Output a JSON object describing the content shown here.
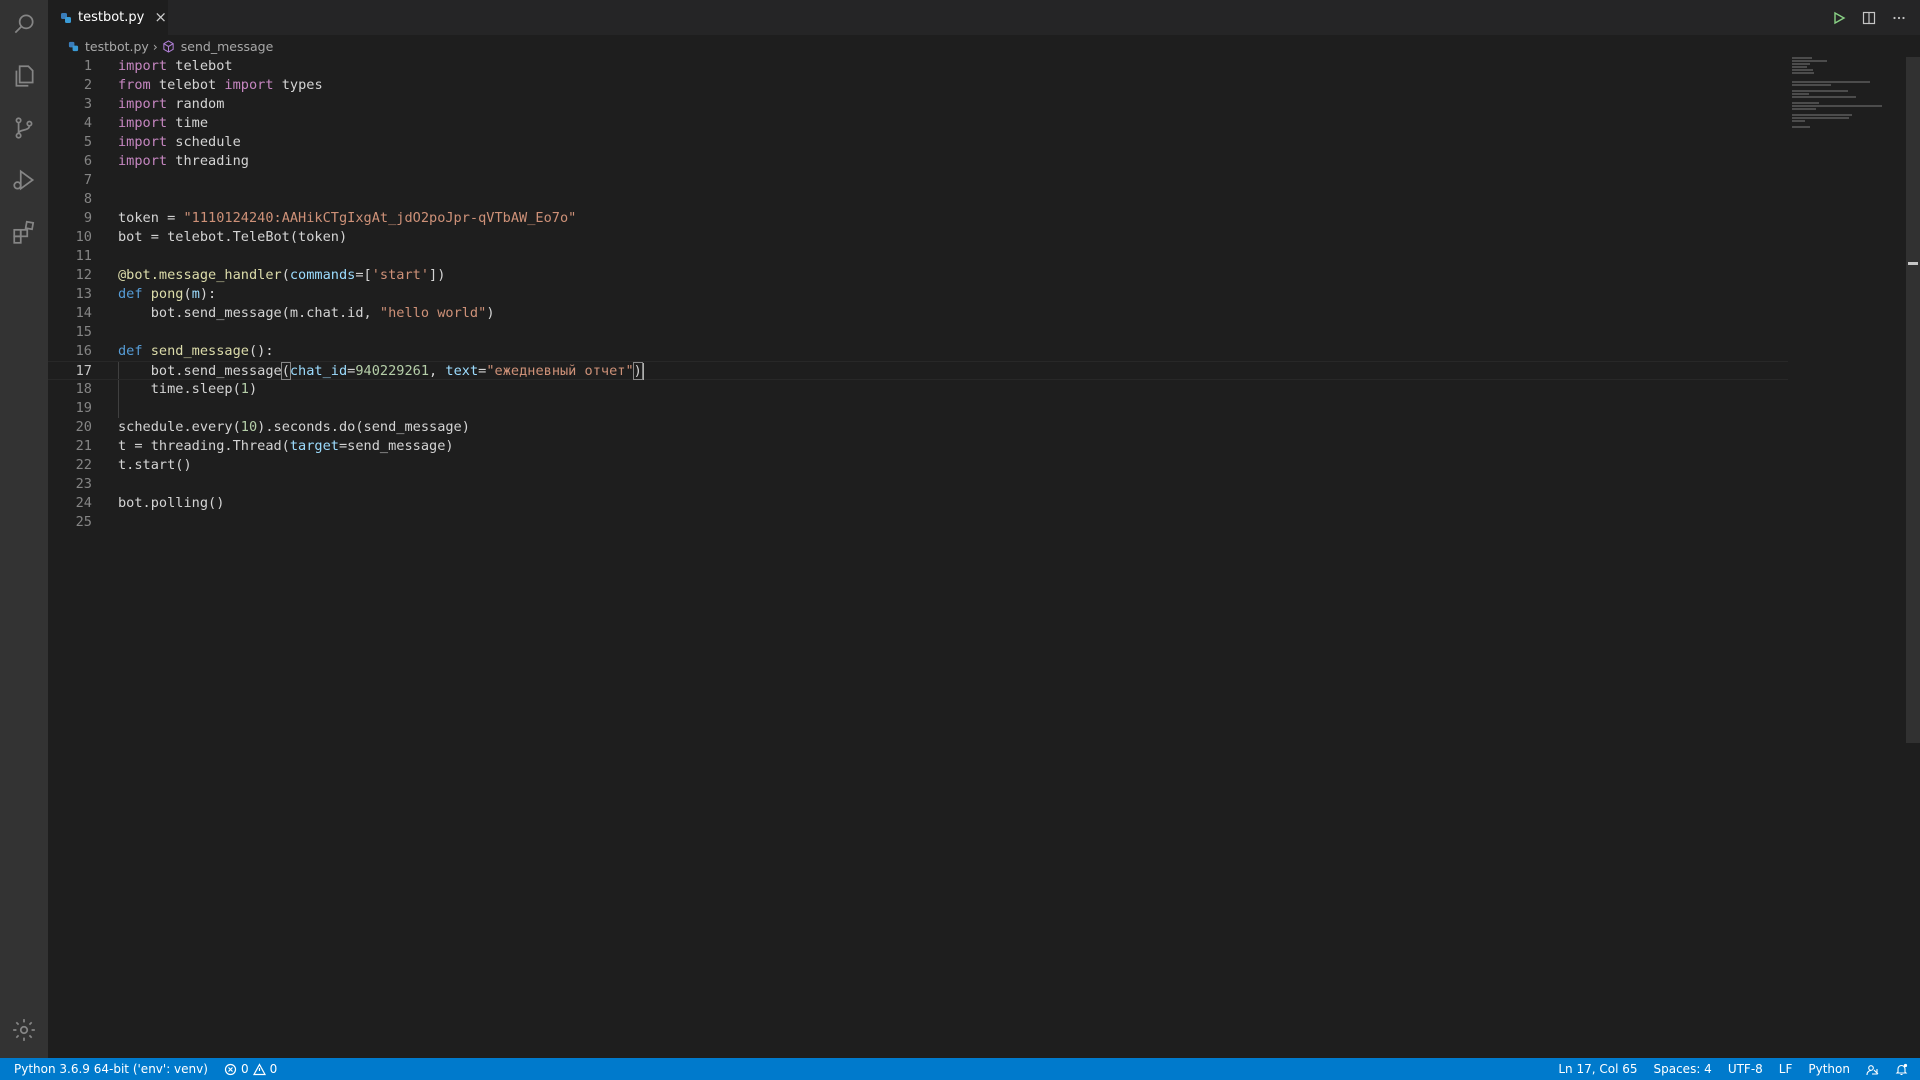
{
  "tab": {
    "filename": "testbot.py",
    "close_glyph": "×"
  },
  "breadcrumb": {
    "file": "testbot.py",
    "symbol": "send_message",
    "separator": "›"
  },
  "activity_bar": [
    "search-icon",
    "explorer-icon",
    "source-control-icon",
    "run-debug-icon",
    "extensions-icon",
    "settings-gear-icon"
  ],
  "editor_actions": [
    "run-icon",
    "split-editor-icon",
    "more-actions-icon"
  ],
  "editor": {
    "current_line": 17,
    "lines": [
      {
        "n": "1",
        "tokens": [
          {
            "t": "import",
            "c": "kw"
          },
          {
            "t": " telebot",
            "c": "plain"
          }
        ]
      },
      {
        "n": "2",
        "tokens": [
          {
            "t": "from",
            "c": "kw"
          },
          {
            "t": " telebot ",
            "c": "plain"
          },
          {
            "t": "import",
            "c": "kw"
          },
          {
            "t": " types",
            "c": "plain"
          }
        ]
      },
      {
        "n": "3",
        "tokens": [
          {
            "t": "import",
            "c": "kw"
          },
          {
            "t": " random",
            "c": "plain"
          }
        ]
      },
      {
        "n": "4",
        "tokens": [
          {
            "t": "import",
            "c": "kw"
          },
          {
            "t": " time",
            "c": "plain"
          }
        ]
      },
      {
        "n": "5",
        "tokens": [
          {
            "t": "import",
            "c": "kw"
          },
          {
            "t": " schedule",
            "c": "plain"
          }
        ]
      },
      {
        "n": "6",
        "tokens": [
          {
            "t": "import",
            "c": "kw"
          },
          {
            "t": " threading",
            "c": "plain"
          }
        ]
      },
      {
        "n": "7",
        "tokens": []
      },
      {
        "n": "8",
        "tokens": []
      },
      {
        "n": "9",
        "tokens": [
          {
            "t": "token = ",
            "c": "plain"
          },
          {
            "t": "\"1110124240:AAHikCTgIxgAt_jdO2poJpr-qVTbAW_Eo7o\"",
            "c": "str"
          }
        ]
      },
      {
        "n": "10",
        "tokens": [
          {
            "t": "bot = telebot.TeleBot(token)",
            "c": "plain"
          }
        ]
      },
      {
        "n": "11",
        "tokens": []
      },
      {
        "n": "12",
        "tokens": [
          {
            "t": "@bot.message_handler",
            "c": "fn"
          },
          {
            "t": "(",
            "c": "plain"
          },
          {
            "t": "commands",
            "c": "param"
          },
          {
            "t": "=[",
            "c": "plain"
          },
          {
            "t": "'start'",
            "c": "str"
          },
          {
            "t": "])",
            "c": "plain"
          }
        ]
      },
      {
        "n": "13",
        "tokens": [
          {
            "t": "def",
            "c": "def"
          },
          {
            "t": " ",
            "c": "plain"
          },
          {
            "t": "pong",
            "c": "fn"
          },
          {
            "t": "(",
            "c": "plain"
          },
          {
            "t": "m",
            "c": "param"
          },
          {
            "t": "):",
            "c": "plain"
          }
        ]
      },
      {
        "n": "14",
        "tokens": [
          {
            "t": "    bot.send_message(m.chat.id, ",
            "c": "plain"
          },
          {
            "t": "\"hello world\"",
            "c": "str"
          },
          {
            "t": ")",
            "c": "plain"
          }
        ]
      },
      {
        "n": "15",
        "tokens": []
      },
      {
        "n": "16",
        "tokens": [
          {
            "t": "def",
            "c": "def"
          },
          {
            "t": " ",
            "c": "plain"
          },
          {
            "t": "send_message",
            "c": "fn"
          },
          {
            "t": "():",
            "c": "plain"
          }
        ]
      },
      {
        "n": "17",
        "tokens": [
          {
            "t": "    bot.send_message",
            "c": "plain"
          },
          {
            "t": "(",
            "c": "plain",
            "hl": true
          },
          {
            "t": "chat_id",
            "c": "param"
          },
          {
            "t": "=",
            "c": "plain"
          },
          {
            "t": "940229261",
            "c": "num"
          },
          {
            "t": ", ",
            "c": "plain"
          },
          {
            "t": "text",
            "c": "param"
          },
          {
            "t": "=",
            "c": "plain"
          },
          {
            "t": "\"ежедневный отчет\"",
            "c": "str"
          },
          {
            "t": ")",
            "c": "plain",
            "hl": true
          },
          {
            "t": "",
            "c": "cursor"
          }
        ]
      },
      {
        "n": "18",
        "tokens": [
          {
            "t": "    time.sleep(",
            "c": "plain"
          },
          {
            "t": "1",
            "c": "num"
          },
          {
            "t": ")",
            "c": "plain"
          }
        ]
      },
      {
        "n": "19",
        "tokens": []
      },
      {
        "n": "20",
        "tokens": [
          {
            "t": "schedule.every(",
            "c": "plain"
          },
          {
            "t": "10",
            "c": "num"
          },
          {
            "t": ").seconds.do(send_message)",
            "c": "plain"
          }
        ]
      },
      {
        "n": "21",
        "tokens": [
          {
            "t": "t = threading.Thread(",
            "c": "plain"
          },
          {
            "t": "target",
            "c": "param"
          },
          {
            "t": "=send_message)",
            "c": "plain"
          }
        ]
      },
      {
        "n": "22",
        "tokens": [
          {
            "t": "t.start()",
            "c": "plain"
          }
        ]
      },
      {
        "n": "23",
        "tokens": []
      },
      {
        "n": "24",
        "tokens": [
          {
            "t": "bot.polling()",
            "c": "plain"
          }
        ]
      },
      {
        "n": "25",
        "tokens": []
      }
    ]
  },
  "statusbar": {
    "interpreter": "Python 3.6.9 64-bit ('env': venv)",
    "errors": "0",
    "warnings": "0",
    "position": "Ln 17, Col 65",
    "spaces": "Spaces: 4",
    "encoding": "UTF-8",
    "eol": "LF",
    "language": "Python"
  },
  "colors": {
    "statusbar": "#007acc",
    "keyword": "#c586c0",
    "def": "#569cd6",
    "function": "#dcdcaa",
    "string": "#ce9178",
    "number": "#b5cea8",
    "param": "#9cdcfe"
  }
}
